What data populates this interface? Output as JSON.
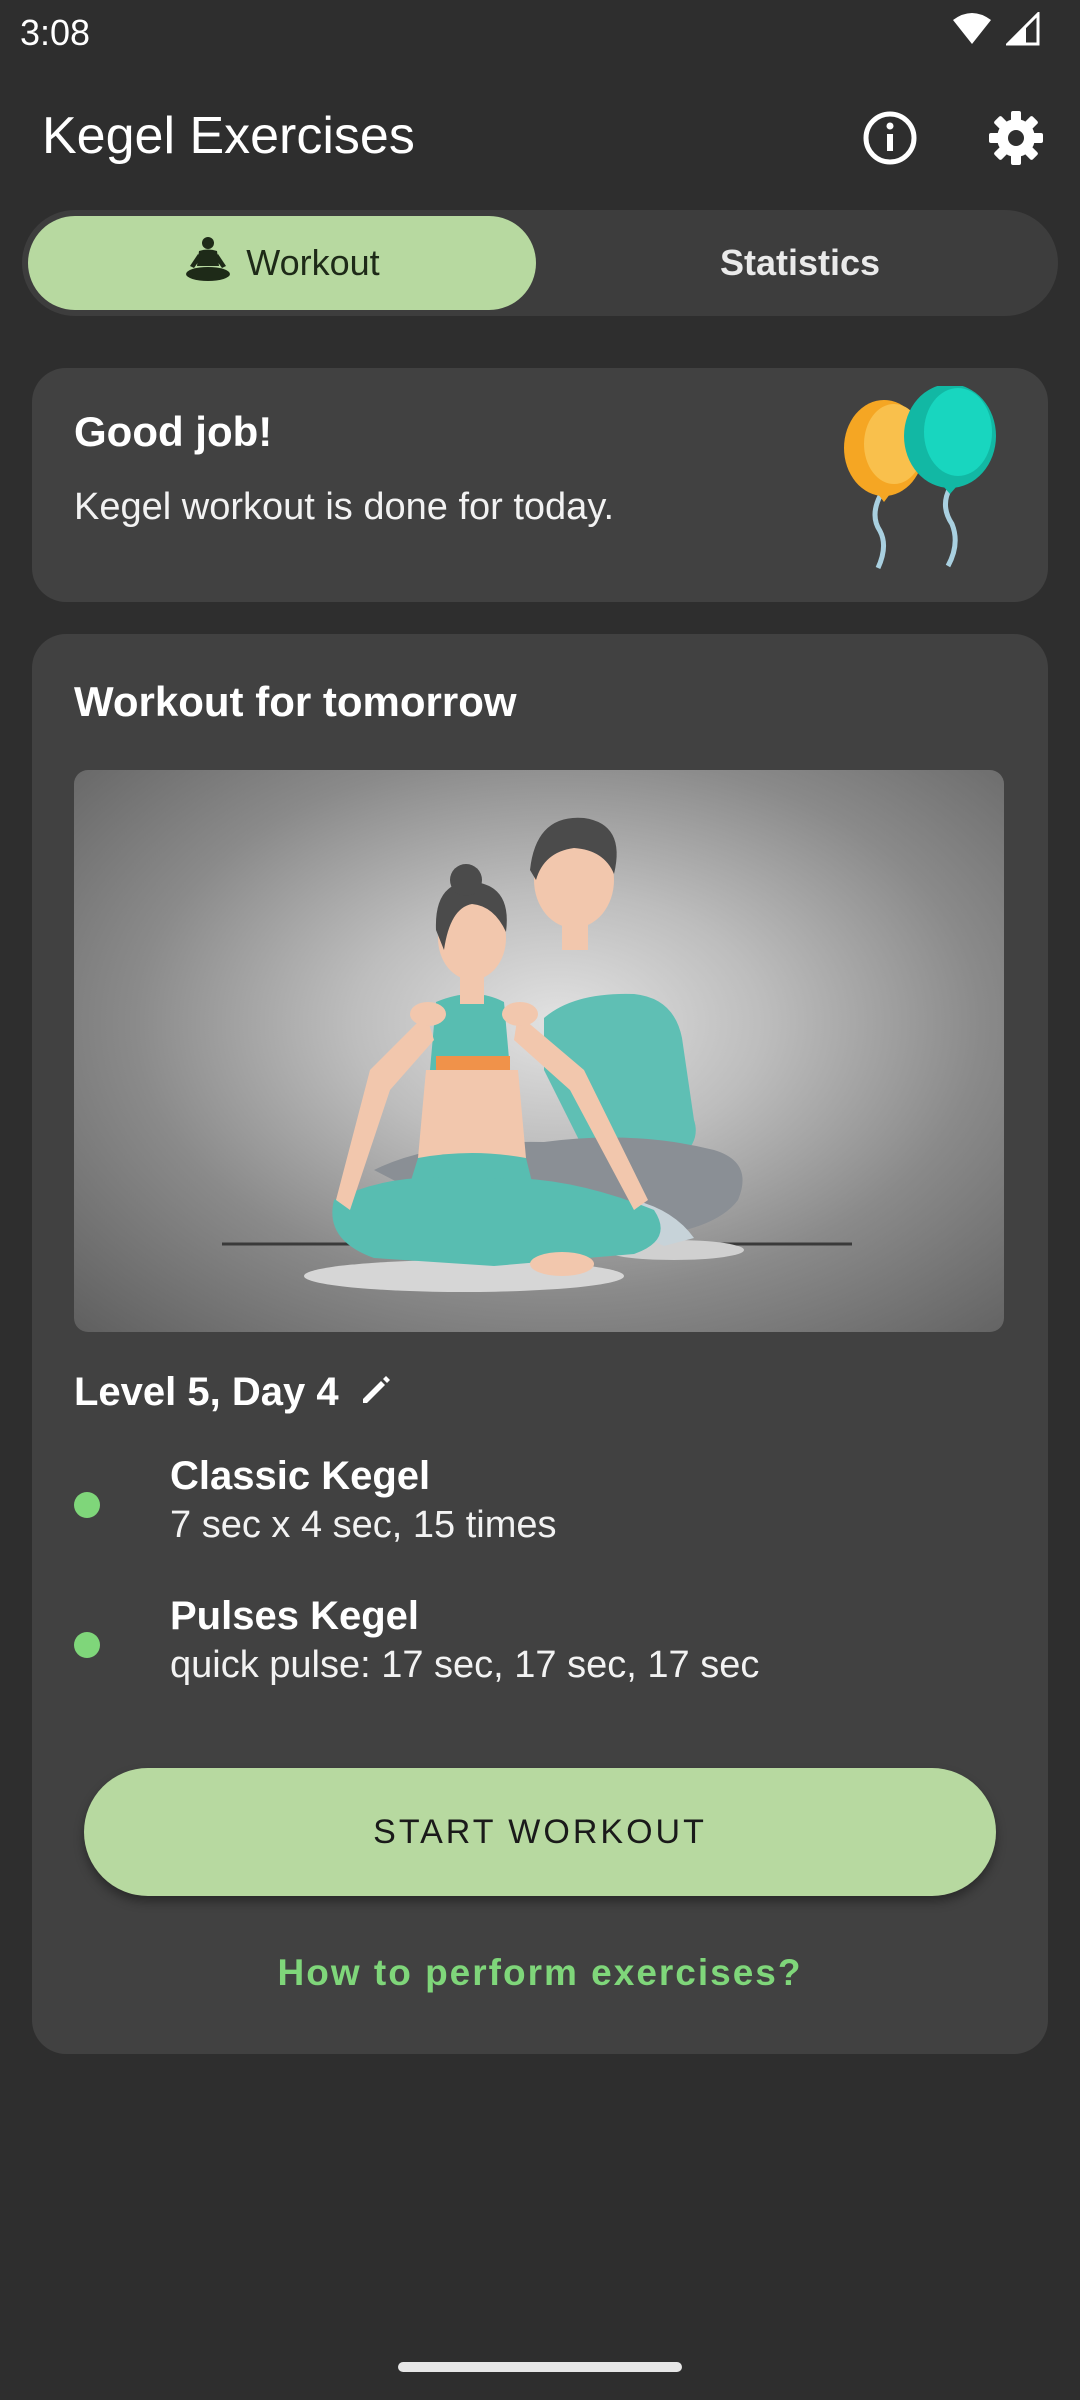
{
  "status_bar": {
    "time": "3:08",
    "wifi_icon": "wifi-icon",
    "signal_icon": "signal-icon"
  },
  "app_bar": {
    "title": "Kegel Exercises",
    "info_icon": "info-icon",
    "settings_icon": "gear-icon"
  },
  "tabs": [
    {
      "label": "Workout",
      "icon": "meditation-icon",
      "selected": true
    },
    {
      "label": "Statistics",
      "selected": false
    }
  ],
  "good_job_card": {
    "title": "Good job!",
    "text": "Kegel workout is done for today.",
    "icon": "balloons-icon"
  },
  "workout_card": {
    "title": "Workout for tomorrow",
    "level": "Level 5, Day 4",
    "edit_icon": "pencil-icon",
    "exercises": [
      {
        "name": "Classic Kegel",
        "detail": "7 sec x 4 sec, 15 times"
      },
      {
        "name": "Pulses Kegel",
        "detail": "quick pulse: 17 sec, 17 sec, 17 sec"
      }
    ],
    "start_button": "START WORKOUT",
    "howto_link": "How to perform exercises?"
  },
  "colors": {
    "background": "#2e2e2e",
    "card": "#414141",
    "accent": "#b7d9a0",
    "link": "#7fd67a"
  }
}
